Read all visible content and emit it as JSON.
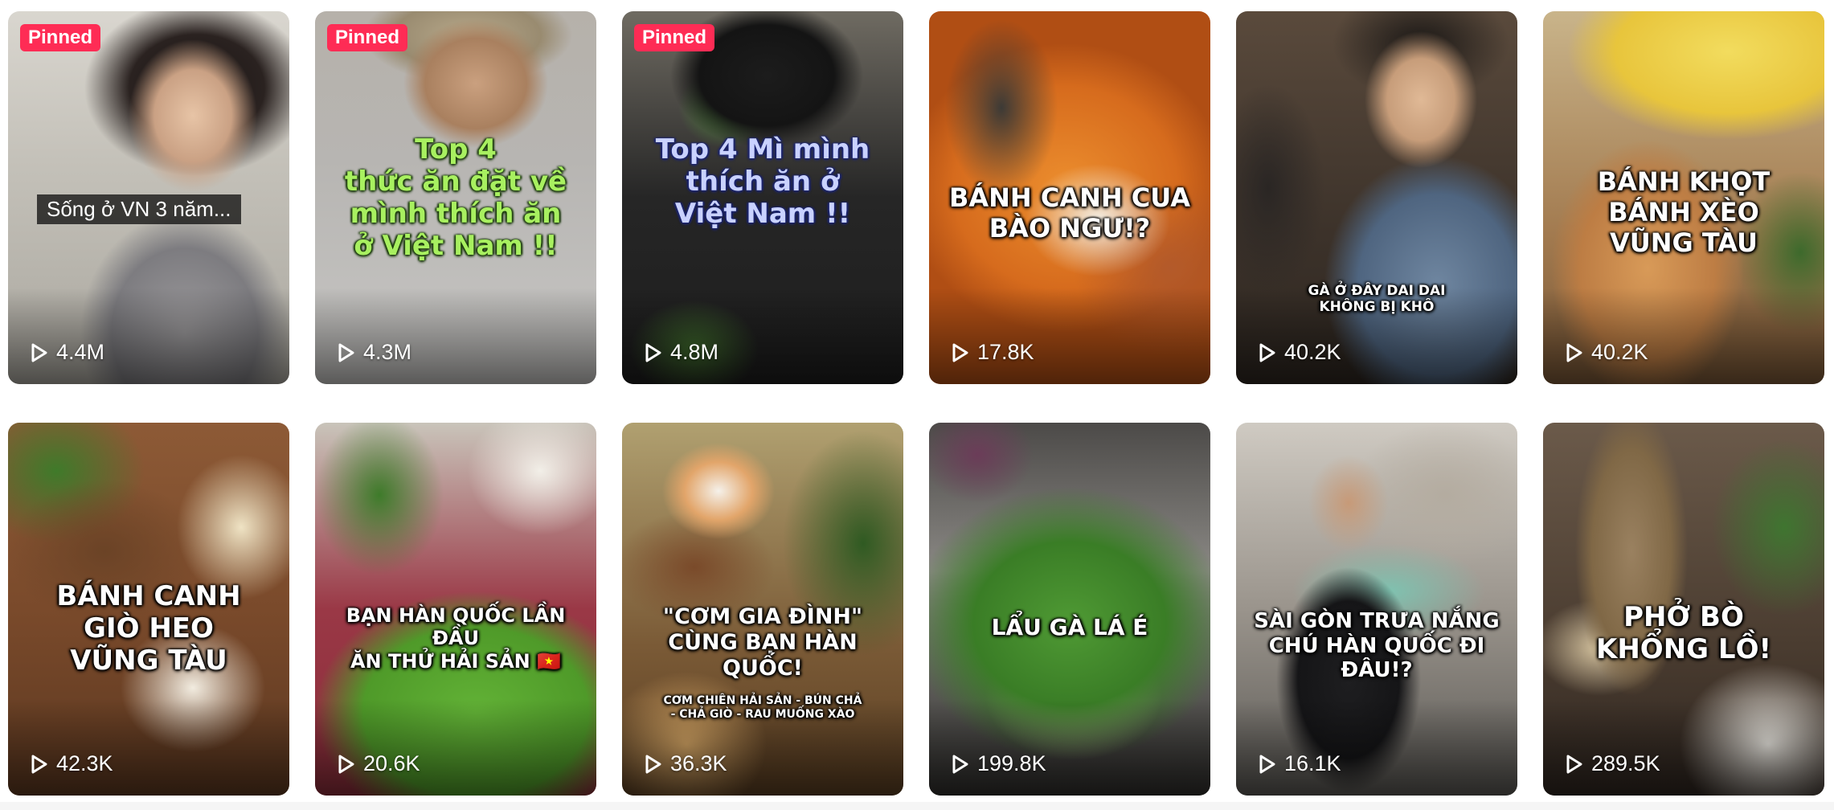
{
  "pinned_label": "Pinned",
  "videos": [
    {
      "views": "4.4M",
      "pinned": true,
      "caption": "Sống ở VN 3 năm...",
      "caption_style": "box"
    },
    {
      "views": "4.3M",
      "pinned": true,
      "caption": "Top 4\nthức ăn đặt về\nmình thích ăn\nở Việt Nam !!",
      "caption_style": "green"
    },
    {
      "views": "4.8M",
      "pinned": true,
      "caption": "Top 4 Mì mình\nthích ăn ở\nViệt Nam !!",
      "caption_style": "blue"
    },
    {
      "views": "17.8K",
      "pinned": false,
      "caption": "BÁNH CANH CUA\nBÀO NGƯ!?",
      "caption_style": "white"
    },
    {
      "views": "40.2K",
      "pinned": false,
      "caption": "GÀ Ở ĐÂY DAI DAI\nKHÔNG BỊ KHÔ",
      "caption_style": "white-small"
    },
    {
      "views": "40.2K",
      "pinned": false,
      "caption": "BÁNH KHỌT\nBÁNH XÈO\nVŨNG TÀU",
      "caption_style": "white"
    },
    {
      "views": "42.3K",
      "pinned": false,
      "caption": "BÁNH CANH\nGIÒ HEO\nVŨNG TÀU",
      "caption_style": "white"
    },
    {
      "views": "20.6K",
      "pinned": false,
      "caption": "BẠN HÀN QUỐC LẦN ĐẦU\nĂN THỬ HẢI SẢN 🇻🇳",
      "caption_style": "white"
    },
    {
      "views": "36.3K",
      "pinned": false,
      "caption": "\"CƠM GIA ĐÌNH\"\nCÙNG BẠN HÀN QUỐC!",
      "sub_caption": "CƠM CHIÊN HẢI SẢN - BÚN CHẢ\n- CHẢ GIÒ - RAU MUỐNG XÀO",
      "caption_style": "white"
    },
    {
      "views": "199.8K",
      "pinned": false,
      "caption": "LẨU GÀ LÁ É",
      "caption_style": "white"
    },
    {
      "views": "16.1K",
      "pinned": false,
      "caption": "SÀI GÒN TRƯA NẮNG\nCHÚ HÀN QUỐC ĐI ĐÂU!?",
      "caption_style": "white"
    },
    {
      "views": "289.5K",
      "pinned": false,
      "caption": "PHỞ BÒ\nKHỔNG LỒ!",
      "caption_style": "white"
    }
  ]
}
